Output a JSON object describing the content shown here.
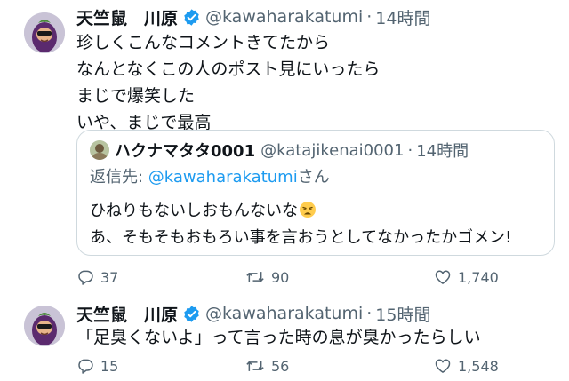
{
  "tweets": [
    {
      "author_name": "天竺鼠　川原",
      "handle": "@kawaharakatumi",
      "separator": "·",
      "time": "14時間",
      "text": "珍しくこんなコメントきてたから\nなんとなくこの人のポスト見にいったら\nまじで爆笑した\nいや、まじで最高",
      "quote": {
        "author_name": "ハクナマタタ0001",
        "handle": "@katajikenai0001",
        "separator": "·",
        "time": "14時間",
        "reply_prefix": "返信先: ",
        "reply_mention": "@kawaharakatumi",
        "reply_suffix": "さん",
        "line1": "ひねりもないしおもんないな",
        "line1_emoji": "weary-face-emoji",
        "line2": "あ、そもそもおもろい事を言おうとしてなかったかゴメン!"
      },
      "replies": "37",
      "retweets": "90",
      "likes": "1,740"
    },
    {
      "author_name": "天竺鼠　川原",
      "handle": "@kawaharakatumi",
      "separator": "·",
      "time": "15時間",
      "text": "「足臭くないよ」って言った時の息が臭かったらしい",
      "replies": "15",
      "retweets": "56",
      "likes": "1,548"
    }
  ],
  "icons": {
    "verified": "verified-badge-icon",
    "reply": "reply-icon",
    "retweet": "retweet-icon",
    "like": "heart-icon"
  },
  "colors": {
    "text": "#0f1419",
    "secondary": "#536471",
    "link": "#1d9bf0",
    "verified": "#1d9bf0",
    "border": "#cfd9de"
  }
}
